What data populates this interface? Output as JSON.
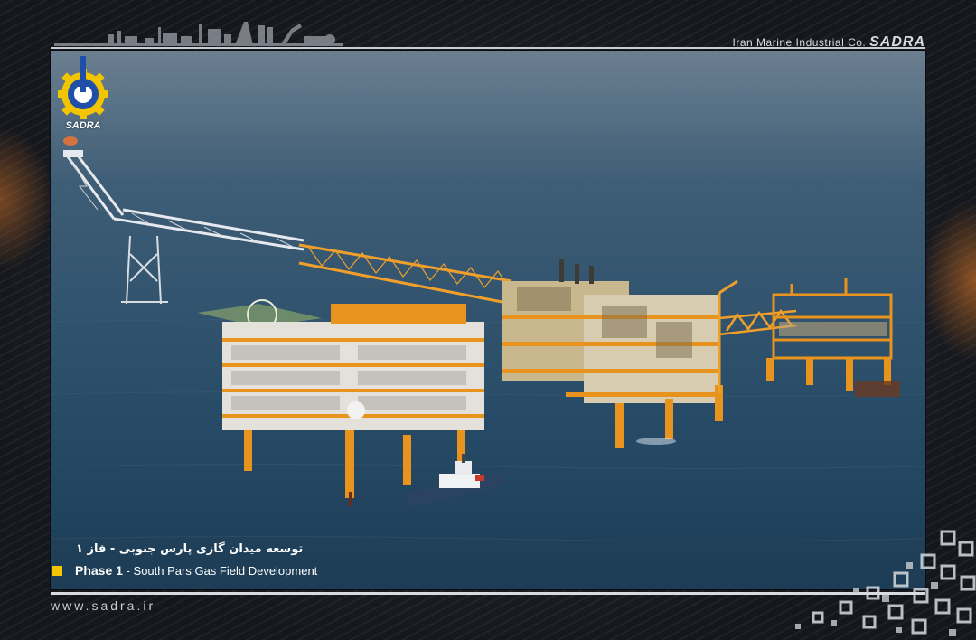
{
  "header": {
    "company_name": "Iran Marine Industrial Co.",
    "company_brand": "SADRA"
  },
  "logo": {
    "text": "SADRA"
  },
  "caption": {
    "persian": "توسعه میدان گازی پارس جنوبی - فاز ۱",
    "phase": "Phase 1",
    "separator": "-",
    "description": "South Pars  Gas Field Development"
  },
  "footer": {
    "url": "www.sadra.ir"
  },
  "colors": {
    "accent_yellow": "#f2c500",
    "platform_orange": "#e8931e",
    "sea": "#2a4f6b"
  }
}
